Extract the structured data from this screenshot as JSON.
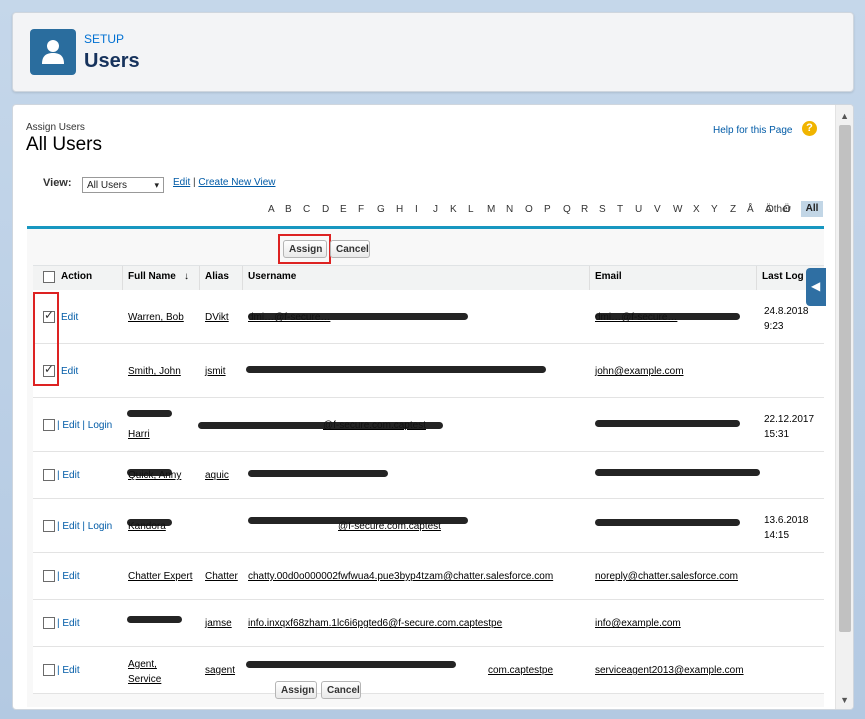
{
  "header": {
    "setup_label": "SETUP",
    "title": "Users"
  },
  "page": {
    "section_label": "Assign Users",
    "title": "All Users",
    "help_link": "Help for this Page",
    "help_icon": "?"
  },
  "view": {
    "label": "View:",
    "selected": "All Users",
    "edit_link": "Edit",
    "separator": "|",
    "create_link": "Create New View"
  },
  "alphabet": [
    "A",
    "B",
    "C",
    "D",
    "E",
    "F",
    "G",
    "H",
    "I",
    "J",
    "K",
    "L",
    "M",
    "N",
    "O",
    "P",
    "Q",
    "R",
    "S",
    "T",
    "U",
    "V",
    "W",
    "X",
    "Y",
    "Z",
    "Å",
    "Ä",
    "Ö",
    "Other"
  ],
  "alphabet_all": "All",
  "buttons": {
    "assign": "Assign",
    "cancel": "Cancel"
  },
  "columns": {
    "action": "Action",
    "full_name": "Full Name",
    "sort_arrow": "↓",
    "alias": "Alias",
    "username": "Username",
    "email": "Email",
    "last_login": "Last Log"
  },
  "rows": [
    {
      "checked": true,
      "actions": "Edit",
      "name1": "Warren, Bob",
      "name2": "",
      "alias": "DVikt",
      "username": "dmi…@f-secure…",
      "email": "dmi…@f-secure…",
      "login1": "24.8.2018",
      "login2": "9:23"
    },
    {
      "checked": true,
      "actions": "Edit",
      "name1": "Smith, John",
      "name2": "",
      "alias": "jsmit",
      "username": "",
      "email": "john@example.com",
      "login1": "",
      "login2": ""
    },
    {
      "checked": false,
      "actions": "| Edit | Login",
      "name1": "",
      "name2": "Harri",
      "alias": "",
      "username": "@f-secure.com.captest",
      "email": "",
      "login1": "22.12.2017",
      "login2": "15:31"
    },
    {
      "checked": false,
      "actions": "| Edit",
      "name1": "Quick, Anny",
      "name2": "",
      "alias": "aquic",
      "username": "",
      "email": "",
      "login1": "",
      "login2": ""
    },
    {
      "checked": false,
      "actions": "| Edit | Login",
      "name1": "Kandora",
      "name2": "",
      "alias": "",
      "username": "@f-secure.com.captest",
      "email": "",
      "login1": "13.6.2018",
      "login2": "14:15"
    },
    {
      "checked": false,
      "actions": "| Edit",
      "name1": "Chatter Expert",
      "name2": "",
      "alias": "Chatter",
      "username": "chatty.00d0o000002fwfwua4.pue3byp4tzam@chatter.salesforce.com",
      "email": "noreply@chatter.salesforce.com",
      "login1": "",
      "login2": ""
    },
    {
      "checked": false,
      "actions": "| Edit",
      "name1": "",
      "name2": "",
      "alias": "jamse",
      "username": "info.inxqxf68zham.1lc6i6pgted6@f-secure.com.captestpe",
      "email": "info@example.com",
      "login1": "",
      "login2": ""
    },
    {
      "checked": false,
      "actions": "| Edit",
      "name1": "Agent,",
      "name2": "Service",
      "alias": "sagent",
      "username": "com.captestpe",
      "email": "serviceagent2013@example.com",
      "login1": "",
      "login2": ""
    }
  ],
  "colors": {
    "accent": "#1797c0",
    "link": "#015ba7",
    "highlight": "#dd2222",
    "header_icon": "#2a6d9e"
  }
}
